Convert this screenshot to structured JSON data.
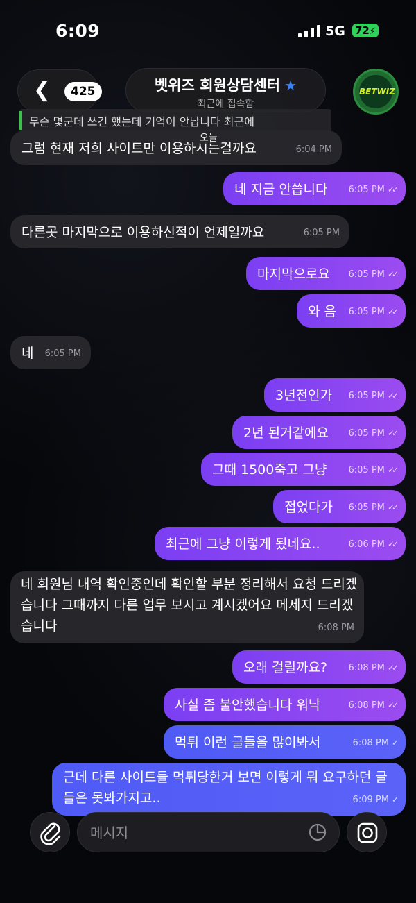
{
  "status_bar": {
    "time": "6:09",
    "network": "5G",
    "battery": "72"
  },
  "header": {
    "back_count": "425",
    "title": "벳위즈 회원상담센터",
    "subtitle": "최근에 접속함",
    "avatar_text": "BETWIZ"
  },
  "reply_preview": "무슨 몇군데 쓰긴 했는데 기억이 안납니다 최근에",
  "date_label": "오늘",
  "messages": [
    {
      "dir": "in",
      "text": "그럼 현재 저희 사이트만 이용하시는걸까요",
      "time": "6:04 PM"
    },
    {
      "dir": "out",
      "text": "네 지금 안씁니다",
      "time": "6:05 PM"
    },
    {
      "dir": "in",
      "text": "다른곳 마지막으로 이용하신적이 언제일까요",
      "time": "6:05 PM"
    },
    {
      "dir": "out",
      "text": "마지막으로요",
      "time": "6:05 PM"
    },
    {
      "dir": "out",
      "text": "와 음",
      "time": "6:05 PM"
    },
    {
      "dir": "in",
      "text": "네",
      "time": "6:05 PM"
    },
    {
      "dir": "out",
      "text": "3년전인가",
      "time": "6:05 PM"
    },
    {
      "dir": "out",
      "text": "2년 된거같에요",
      "time": "6:05 PM"
    },
    {
      "dir": "out",
      "text": "그때 1500죽고 그냥",
      "time": "6:05 PM"
    },
    {
      "dir": "out",
      "text": "접었다가",
      "time": "6:05 PM"
    },
    {
      "dir": "out",
      "text": "최근에 그냥 이렇게 됬네요..",
      "time": "6:06 PM"
    },
    {
      "dir": "in",
      "text": "네 회원님 내역 확인중인데 확인할 부분 정리해서 요청 드리겠습니다 그때까지 다른 업무 보시고 계시겠어요 메세지 드리겠습니다",
      "time": "6:08 PM"
    },
    {
      "dir": "out",
      "text": "오래 걸릴까요?",
      "time": "6:08 PM"
    },
    {
      "dir": "out",
      "text": "사실 좀 불안했습니다 워낙",
      "time": "6:08 PM"
    },
    {
      "dir": "out",
      "text": "먹튀 이런 글들을 많이봐서",
      "time": "6:08 PM"
    },
    {
      "dir": "out",
      "text": "근데 다른 사이트들 먹튀당한거 보면 이렇게 뭐 요구하던 글들은 못봐가지고..",
      "time": "6:09 PM"
    }
  ],
  "composer": {
    "placeholder": "메시지"
  },
  "icons": {
    "back": "chevron-left-icon",
    "verified": "star-icon",
    "attach": "paperclip-icon",
    "sticker": "sticker-icon",
    "camera": "camera-icon"
  },
  "colors": {
    "outgoing_purple": "#8a45f2",
    "outgoing_blue": "#5660f7",
    "incoming": "#26262b",
    "verified_star": "#3b82f6",
    "battery": "#30d158"
  }
}
